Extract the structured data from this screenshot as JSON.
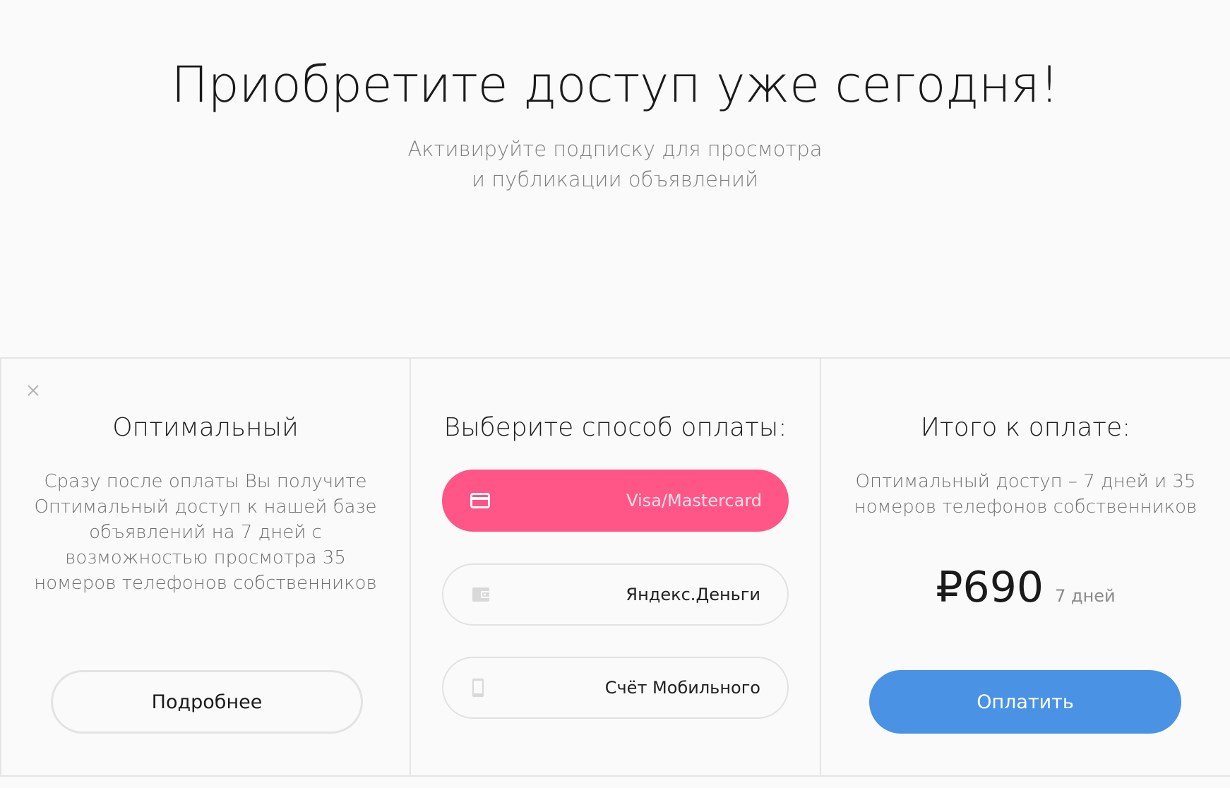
{
  "hero": {
    "title": "Приобретите доступ уже сегодня!",
    "subtitle_line1": "Активируйте подписку для просмотра",
    "subtitle_line2": "и публикации объявлений"
  },
  "plan": {
    "close_icon": "close-icon",
    "title": "Оптимальный",
    "description": "Сразу после оплаты Вы получите Оптимальный доступ к нашей базе объявлений на 7 дней с возможностью просмотра 35 номеров телефонов собственников",
    "details_button": "Подробнее"
  },
  "payment": {
    "title": "Выберите способ оплаты:",
    "options": [
      {
        "label": "Visa/Mastercard",
        "icon": "credit-card-icon",
        "selected": true
      },
      {
        "label": "Яндекс.Деньги",
        "icon": "wallet-icon",
        "selected": false
      },
      {
        "label": "Счёт Мобильного",
        "icon": "mobile-phone-icon",
        "selected": false
      }
    ]
  },
  "summary": {
    "title": "Итого к оплате:",
    "description": "Оптимальный доступ – 7 дней и 35 номеров телефонов собственников",
    "price": "₽690",
    "period": "7 дней",
    "pay_button": "Оплатить"
  },
  "colors": {
    "background": "#fafafa",
    "accent_pink": "#ff5587",
    "accent_blue": "#4a92e4",
    "border": "#e5e5e5"
  }
}
